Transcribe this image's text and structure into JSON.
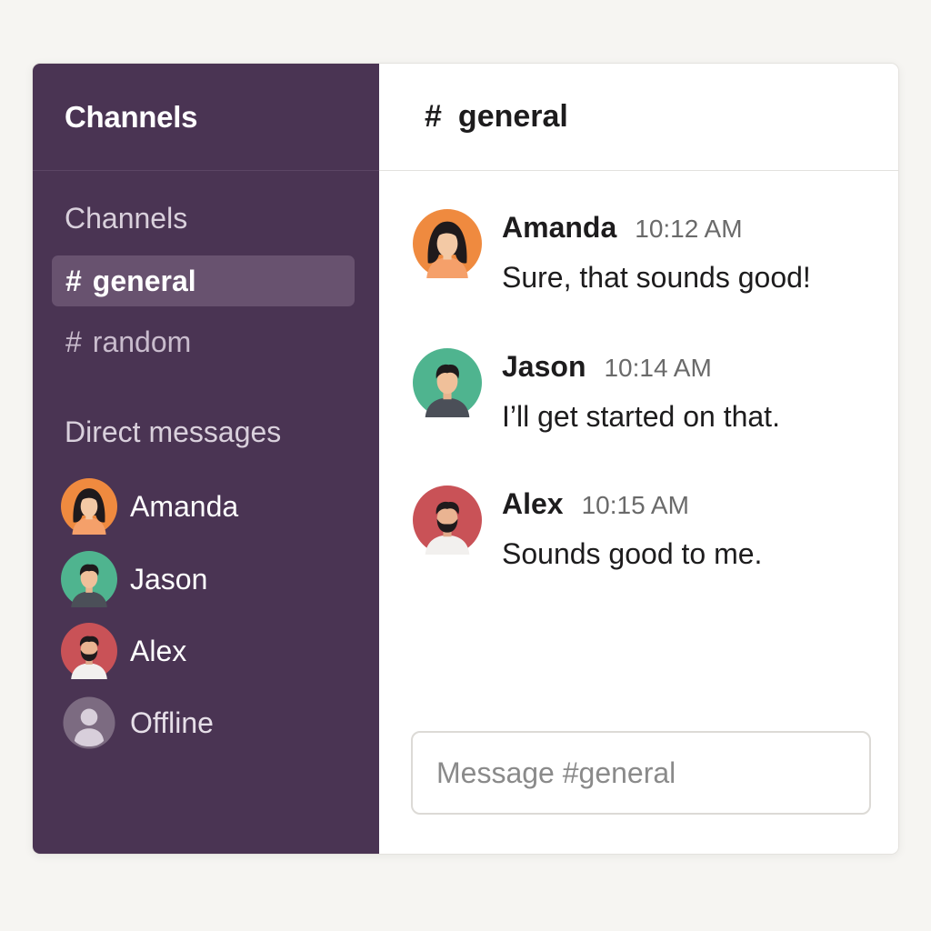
{
  "sidebar": {
    "title": "Channels",
    "channels_label": "Channels",
    "channels": [
      {
        "hash": "#",
        "name": "general",
        "active": true
      },
      {
        "hash": "#",
        "name": "random",
        "active": false
      }
    ],
    "dm_label": "Direct messages",
    "direct_messages": [
      {
        "name": "Amanda",
        "avatar_color": "#ef8a3f"
      },
      {
        "name": "Jason",
        "avatar_color": "#4fb48f"
      },
      {
        "name": "Alex",
        "avatar_color": "#c95257"
      },
      {
        "name": "Offline",
        "avatar_color": "#7c6b81"
      }
    ]
  },
  "header": {
    "hash": "#",
    "channel_name": "general"
  },
  "messages": [
    {
      "author": "Amanda",
      "time": "10:12 AM",
      "text": "Sure, that sounds good!",
      "avatar_color": "#ef8a3f"
    },
    {
      "author": "Jason",
      "time": "10:14 AM",
      "text": "I’ll get started on that.",
      "avatar_color": "#4fb48f"
    },
    {
      "author": "Alex",
      "time": "10:15 AM",
      "text": "Sounds good to me.",
      "avatar_color": "#c95257"
    }
  ],
  "composer": {
    "placeholder": "Message #general"
  },
  "colors": {
    "sidebar_bg": "#4a3453",
    "active_channel_bg": "#68526f"
  }
}
